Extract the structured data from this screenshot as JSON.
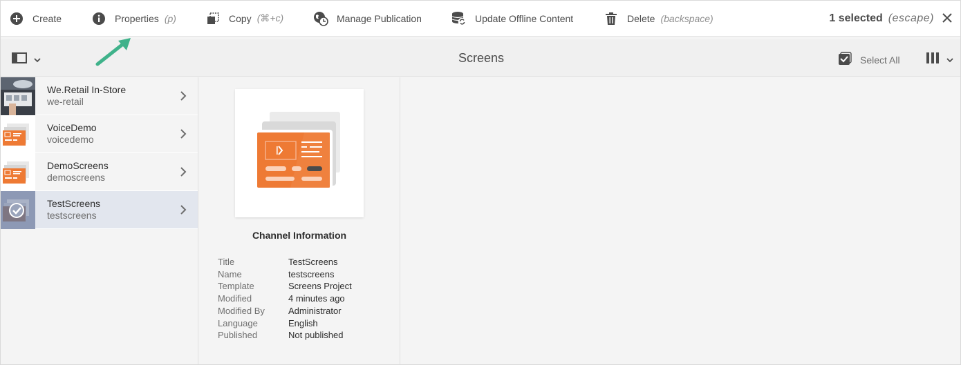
{
  "actionbar": {
    "create": {
      "label": "Create",
      "icon": "plus-circle-icon"
    },
    "properties": {
      "label": "Properties",
      "hint": "(p)",
      "icon": "info-icon"
    },
    "copy": {
      "label": "Copy",
      "hint": "(⌘+c)",
      "icon": "copy-icon"
    },
    "manage_publication": {
      "label": "Manage Publication",
      "icon": "globe-clock-icon"
    },
    "update_offline": {
      "label": "Update Offline Content",
      "icon": "database-refresh-icon"
    },
    "delete": {
      "label": "Delete",
      "hint": "(backspace)",
      "icon": "trash-icon"
    },
    "selection": {
      "count_text": "1 selected",
      "escape_hint": "(escape)"
    },
    "close_icon": "close-icon"
  },
  "titlebar": {
    "title": "Screens",
    "select_all": "Select All"
  },
  "column1": {
    "items": [
      {
        "title": "We.Retail In-Store",
        "name": "we-retail",
        "selected": false
      },
      {
        "title": "VoiceDemo",
        "name": "voicedemo",
        "selected": false
      },
      {
        "title": "DemoScreens",
        "name": "demoscreens",
        "selected": false
      },
      {
        "title": "TestScreens",
        "name": "testscreens",
        "selected": true
      }
    ]
  },
  "details": {
    "heading": "Channel Information",
    "rows": [
      {
        "key": "Title",
        "value": "TestScreens"
      },
      {
        "key": "Name",
        "value": "testscreens"
      },
      {
        "key": "Template",
        "value": "Screens Project"
      },
      {
        "key": "Modified",
        "value": "4 minutes ago"
      },
      {
        "key": "Modified By",
        "value": "Administrator"
      },
      {
        "key": "Language",
        "value": "English"
      },
      {
        "key": "Published",
        "value": "Not published"
      }
    ]
  },
  "colors": {
    "accent_orange": "#ee7a34",
    "selected_row": "#e2e6ee",
    "annotation_arrow": "#3fb28a"
  }
}
